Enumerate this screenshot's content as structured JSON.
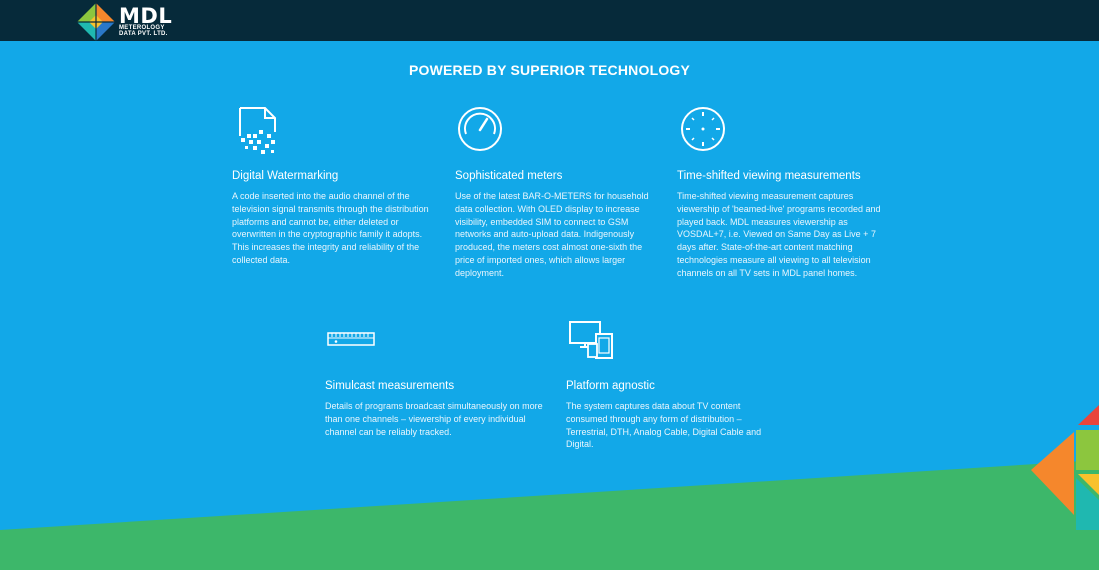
{
  "brand": {
    "name": "MDL",
    "subtitle_line1": "METEROLOGY",
    "subtitle_line2": "DATA PVT. LTD."
  },
  "headline": "POWERED BY SUPERIOR TECHNOLOGY",
  "features": [
    {
      "icon": "digital-watermark-icon",
      "title": "Digital Watermarking",
      "description": "A code inserted into the audio channel of the television signal transmits through the distribution platforms and cannot be, either deleted or overwritten in the cryptographic family it adopts. This increases the integrity and reliability of the collected data."
    },
    {
      "icon": "meter-gauge-icon",
      "title": "Sophisticated meters",
      "description": "Use of the latest BAR-O-METERS for household data collection. With OLED display to increase visibility, embedded SIM to connect to GSM networks and auto-upload data. Indigenously produced, the meters cost almost one-sixth the price of imported ones, which allows larger deployment."
    },
    {
      "icon": "clock-icon",
      "title": "Time-shifted viewing measurements",
      "description": "Time-shifted viewing measurement captures viewership of 'beamed-live' programs recorded and played back. MDL measures viewership as VOSDAL+7, i.e. Viewed on Same Day as Live + 7 days after. State-of-the-art content matching technologies measure all viewing to all television channels on all TV sets in MDL panel homes."
    },
    {
      "icon": "set-top-box-icon",
      "title": "Simulcast measurements",
      "description": "Details of programs broadcast simultaneously on more than one channels – viewership of every individual channel can be reliably tracked."
    },
    {
      "icon": "multi-device-icon",
      "title": "Platform agnostic",
      "description": "The system captures data about TV content consumed through any form of distribution – Terrestrial, DTH, Analog Cable, Digital Cable and Digital."
    }
  ],
  "colors": {
    "background": "#12a8e8",
    "topbar": "#062a3a",
    "green_band": "#3db76a",
    "accent_orange": "#f5872c",
    "accent_red": "#e8453c",
    "accent_lime": "#8cc63e",
    "accent_yellow": "#f8c12c",
    "accent_teal": "#1fb8b0"
  }
}
